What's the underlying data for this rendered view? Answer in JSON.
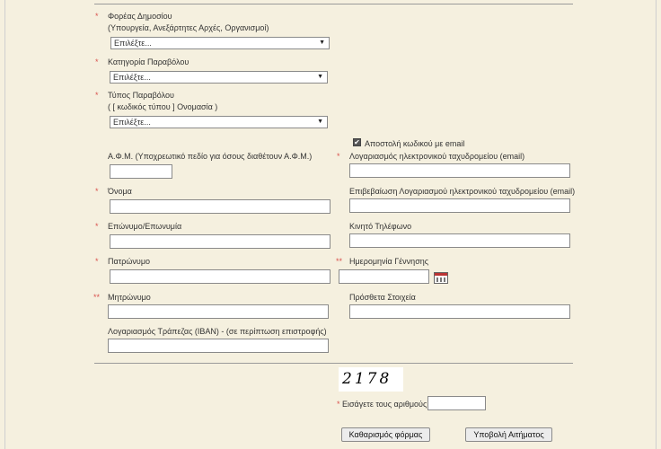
{
  "form": {
    "foreas": {
      "label": "Φορέας Δημοσίου",
      "sublabel": "(Υπουργεία, Ανεξάρτητες Αρχές, Οργανισμοί)",
      "value": "Επιλέξτε..."
    },
    "katigoria": {
      "label": "Κατηγορία Παραβόλου",
      "value": "Επιλέξτε..."
    },
    "typos": {
      "label": "Τύπος Παραβόλου",
      "sublabel": "( [ κωδικός τύπου ] Ονομασία )",
      "value": "Επιλέξτε..."
    },
    "email_code": {
      "label": "Αποστολή κωδικού με email",
      "checked": true
    },
    "afm": {
      "label": "Α.Φ.Μ. (Υποχρεωτικό πεδίο για όσους διαθέτουν Α.Φ.Μ.)",
      "value": ""
    },
    "email": {
      "label": "Λογαριασμός ηλεκτρονικού ταχυδρομείου (email)",
      "value": ""
    },
    "onoma": {
      "label": "Όνομα",
      "value": ""
    },
    "email_confirm": {
      "label": "Επιβεβαίωση Λογαριασμού ηλεκτρονικού ταχυδρομείου (email)",
      "value": ""
    },
    "eponymo": {
      "label": "Επώνυμο/Επωνυμία",
      "value": ""
    },
    "kinito": {
      "label": "Κινητό Τηλέφωνο",
      "value": ""
    },
    "patronymo": {
      "label": "Πατρώνυμο",
      "value": ""
    },
    "birthdate": {
      "label": "Ημερομηνία Γέννησης",
      "value": ""
    },
    "mitronymo": {
      "label": "Μητρώνυμο",
      "value": ""
    },
    "extra": {
      "label": "Πρόσθετα Στοιχεία",
      "value": ""
    },
    "iban": {
      "label": "Λογαριασμός Τράπεζας (IBAN) - (σε περίπτωση επιστροφής)",
      "value": ""
    }
  },
  "required_mark": "*",
  "double_required_mark": "**",
  "captcha": {
    "code": "2178",
    "label": "Εισάγετε τους αριθμούς",
    "value": ""
  },
  "buttons": {
    "clear": "Καθαρισμός φόρμας",
    "submit": "Υποβολή Αιτήματος"
  },
  "icons": {
    "select_arrow": "▼",
    "checkmark": "✔"
  }
}
